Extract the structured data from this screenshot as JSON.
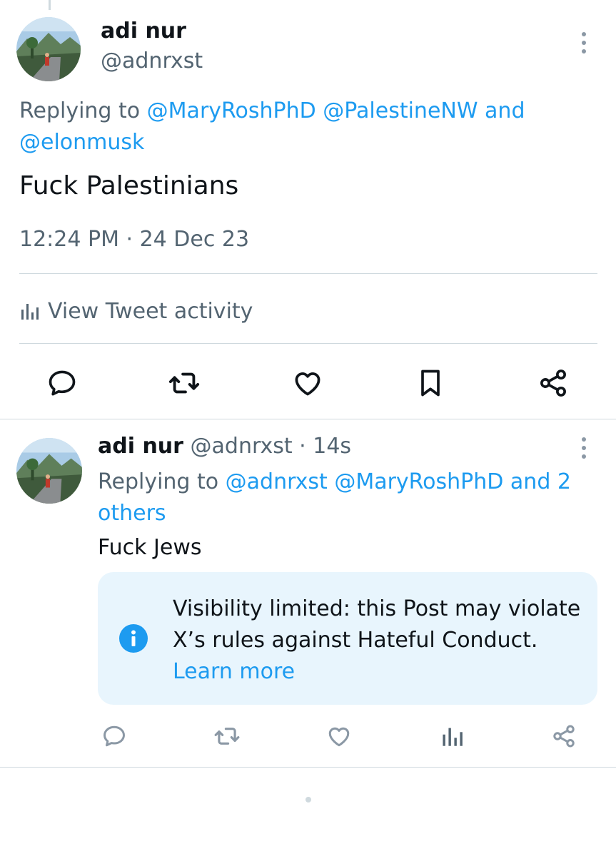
{
  "main_tweet": {
    "author_name": "adi nur",
    "author_handle": "@adnrxst",
    "replying_prefix": "Replying to ",
    "replying_mentions": [
      "@MaryRoshPhD",
      "@PalestineNW"
    ],
    "replying_conjunction": " and",
    "replying_last": "@elonmusk",
    "text": "Fuck Palestinians",
    "timestamp": "12:24 PM · 24 Dec 23",
    "activity_label": "View Tweet activity",
    "actions": [
      "reply-icon",
      "retweet-icon",
      "like-icon",
      "bookmark-icon",
      "share-icon"
    ]
  },
  "reply_tweet": {
    "author_name": "adi nur",
    "author_handle": "@adnrxst",
    "separator": " · ",
    "time": "14s",
    "replying_prefix": "Replying to ",
    "replying_mentions": "@adnrxst @MaryRoshPhD",
    "replying_others": " and 2 others",
    "text": "Fuck Jews",
    "notice_text": "Visibility limited: this Post may violate X’s rules against Hateful Conduct.",
    "notice_link": "Learn more",
    "actions": [
      "reply-icon",
      "retweet-icon",
      "like-icon",
      "analytics-icon",
      "share-icon"
    ]
  },
  "colors": {
    "accent": "#1d9bf0",
    "text_primary": "#0f1419",
    "text_secondary": "#536471",
    "divider": "#cfd9de",
    "notice_background": "#e8f5fd"
  }
}
